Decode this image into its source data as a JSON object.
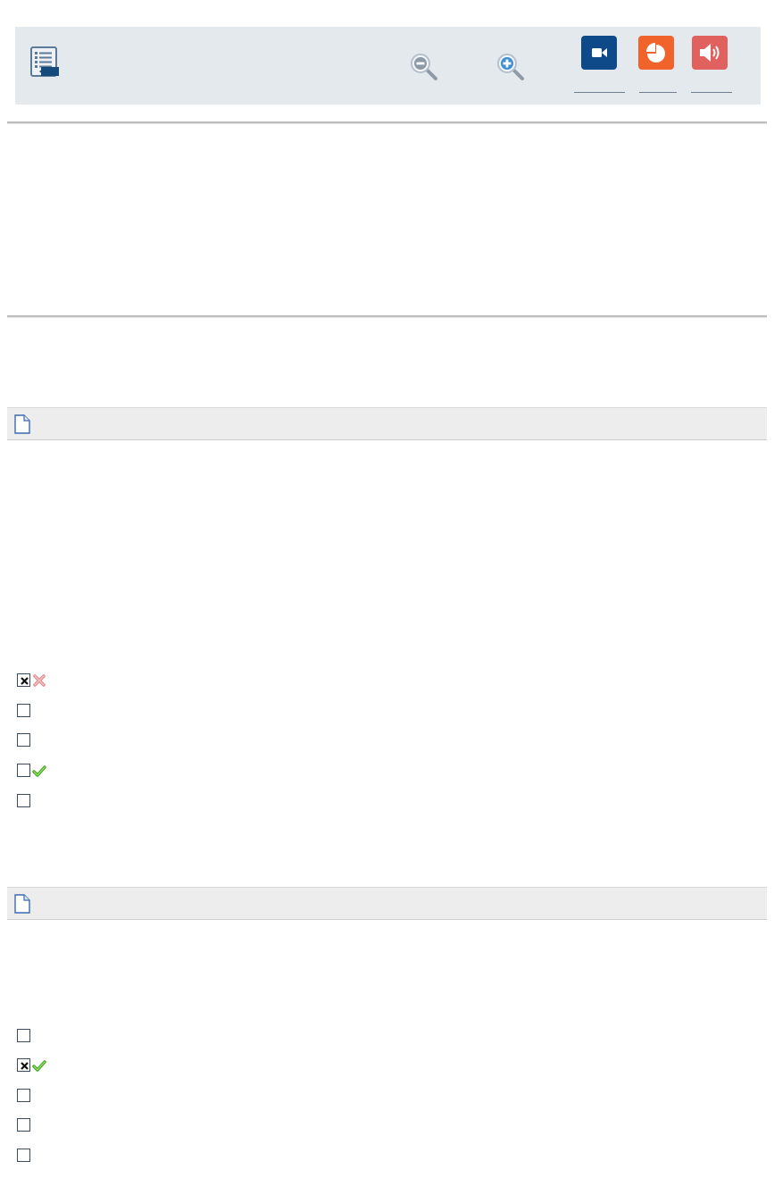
{
  "toolbar": {
    "icons": [
      "document-list-icon",
      "zoom-out-icon",
      "zoom-in-icon",
      "video-icon",
      "pie-chart-icon",
      "speaker-icon"
    ],
    "colors": {
      "background": "#e4e9ed",
      "video": "#0e4a8a",
      "chart": "#f0632a",
      "audio": "#e0615e"
    }
  },
  "questions": [
    {
      "text": "",
      "icon": "page-icon",
      "options": [
        {
          "label": "",
          "checked": true,
          "mark": "wrong"
        },
        {
          "label": "",
          "checked": false,
          "mark": "none"
        },
        {
          "label": "",
          "checked": false,
          "mark": "none"
        },
        {
          "label": "",
          "checked": false,
          "mark": "correct"
        },
        {
          "label": "",
          "checked": false,
          "mark": "none"
        }
      ]
    },
    {
      "text": "",
      "icon": "page-icon",
      "options": [
        {
          "label": "",
          "checked": false,
          "mark": "none"
        },
        {
          "label": "",
          "checked": true,
          "mark": "correct"
        },
        {
          "label": "",
          "checked": false,
          "mark": "none"
        },
        {
          "label": "",
          "checked": false,
          "mark": "none"
        },
        {
          "label": "",
          "checked": false,
          "mark": "none"
        }
      ]
    }
  ]
}
